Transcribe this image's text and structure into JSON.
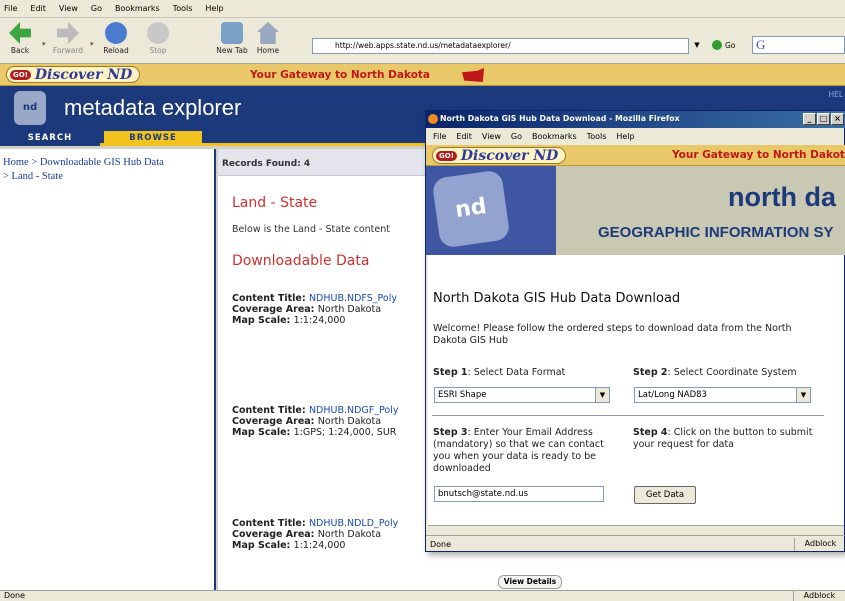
{
  "menu": [
    "File",
    "Edit",
    "View",
    "Go",
    "Bookmarks",
    "Tools",
    "Help"
  ],
  "toolbar": {
    "back": "Back",
    "forward": "Forward",
    "reload": "Reload",
    "stop": "Stop",
    "newtab": "New Tab",
    "home": "Home",
    "url": "http://web.apps.state.nd.us/metadataexplorer/",
    "go": "Go",
    "google": "G"
  },
  "discover": {
    "logo_go": "GO!",
    "logo_text": "Discover ND",
    "gateway": "Your Gateway to North Dakota"
  },
  "header": {
    "logo": "nd GIS",
    "title": "metadata explorer",
    "hel": "HEL"
  },
  "tabs": {
    "search": "SEARCH",
    "browse": "BROWSE"
  },
  "sidebar": {
    "home": "Home",
    "sep": " > ",
    "crumb2": "Downloadable GIS Hub Data",
    "crumb3": "Land - State"
  },
  "main": {
    "records": "Records Found: 4",
    "heading": "Land - State",
    "below": "Below is the Land - State content",
    "downloadable": "Downloadable Data",
    "labels": {
      "title": "Content Title:",
      "area": "Coverage Area:",
      "scale": "Map Scale:"
    },
    "items": [
      {
        "title": "NDHUB.NDFS_Poly",
        "area": "North Dakota",
        "scale": "1:1:24,000"
      },
      {
        "title": "NDHUB.NDGF_Poly",
        "area": "North Dakota",
        "scale": "1:GPS; 1:24,000, SUR"
      },
      {
        "title": "NDHUB.NDLD_Poly",
        "area": "North Dakota",
        "scale": "1:1:24,000"
      }
    ],
    "view_details": "View Details"
  },
  "status": {
    "text": "Done",
    "adblock": "Adblock"
  },
  "popup": {
    "title": "North Dakota GIS Hub Data Download - Mozilla Firefox",
    "menu": [
      "File",
      "Edit",
      "View",
      "Go",
      "Bookmarks",
      "Tools",
      "Help"
    ],
    "gateway": "Your Gateway to North Dakot",
    "banner1": "north da",
    "banner2": "GEOGRAPHIC INFORMATION SY",
    "banner_logo": "nd GIS",
    "heading": "North Dakota GIS Hub Data Download",
    "welcome": "Welcome! Please follow the ordered steps to download data from the North Dakota GIS Hub",
    "step1_label": "Step 1",
    "step1_text": ": Select Data Format",
    "step1_value": "ESRI Shape",
    "step2_label": "Step 2",
    "step2_text": ": Select Coordinate System",
    "step2_value": "Lat/Long NAD83",
    "step3_label": "Step 3",
    "step3_text": ": Enter Your Email Address (mandatory) so that we can contact you when your data is ready to be downloaded",
    "step4_label": "Step 4",
    "step4_text": ": Click on the button to submit your request for data",
    "email": "bnutsch@state.nd.us",
    "button": "Get Data",
    "status": "Done",
    "adblock": "Adblock"
  },
  "colors": {
    "navy": "#1c3a7b",
    "accent_red": "#d22f2f",
    "gold": "#f2c21e"
  }
}
